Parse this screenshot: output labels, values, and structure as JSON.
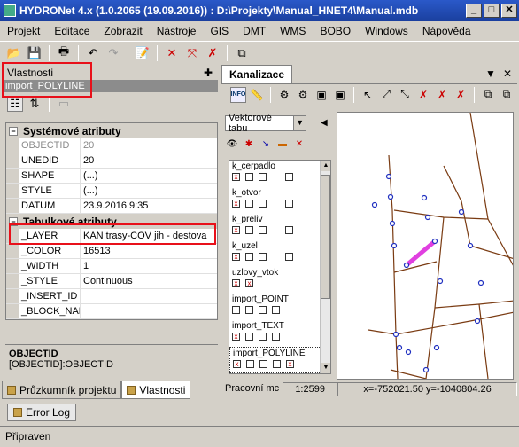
{
  "window": {
    "title": "HYDRONet 4.x (1.0.2065 (19.09.2016)) : D:\\Projekty\\Manual_HNET4\\Manual.mdb",
    "min": "_",
    "max": "□",
    "close": "✕"
  },
  "menu": [
    "Projekt",
    "Editace",
    "Zobrazit",
    "Nástroje",
    "GIS",
    "DMT",
    "WMS",
    "BOBO",
    "Windows",
    "Nápověda"
  ],
  "properties": {
    "header": "Vlastnosti",
    "pin": "✚",
    "object": "import_POLYLINE",
    "categories": [
      {
        "label": "Systémové atributy",
        "toggle": "−"
      },
      {
        "label": "Tabulkové atributy",
        "toggle": "−"
      }
    ],
    "system_rows": [
      {
        "key": "OBJECTID",
        "value": "20"
      },
      {
        "key": "UNEDID",
        "value": "20"
      },
      {
        "key": "SHAPE",
        "value": "(...)"
      },
      {
        "key": "STYLE",
        "value": "(...)"
      },
      {
        "key": "DATUM",
        "value": "23.9.2016 9:35"
      }
    ],
    "table_rows": [
      {
        "key": "_LAYER",
        "value": "KAN trasy-COV jih - destova"
      },
      {
        "key": "_COLOR",
        "value": "16513"
      },
      {
        "key": "_WIDTH",
        "value": "1"
      },
      {
        "key": "_STYLE",
        "value": "Continuous"
      },
      {
        "key": "_INSERT_ID",
        "value": ""
      },
      {
        "key": "_BLOCK_NAM",
        "value": ""
      }
    ],
    "desc_title": "OBJECTID",
    "desc_text": "[OBJECTID]:OBJECTID"
  },
  "left_tabs": [
    "Průzkumník projektu",
    "Vlastnosti"
  ],
  "error_tab": "Error Log",
  "status": "Připraven",
  "map_panel": {
    "tab": "Kanalizace",
    "menu_glyph": "▼",
    "close_glyph": "✕",
    "info_label": "INFO",
    "combo_value": "Vektorové tabu",
    "layers": [
      {
        "name": "k_cerpadlo",
        "checks": [
          "x",
          "",
          "",
          "",
          ""
        ]
      },
      {
        "name": "k_otvor",
        "checks": [
          "x",
          "",
          "",
          "",
          ""
        ]
      },
      {
        "name": "k_preliv",
        "checks": [
          "x",
          "",
          "",
          "",
          ""
        ]
      },
      {
        "name": "k_uzel",
        "checks": [
          "x",
          "",
          "",
          "",
          ""
        ]
      },
      {
        "name": "uzlovy_vtok",
        "checks": [
          "x",
          "x",
          "",
          "",
          ""
        ]
      },
      {
        "name": "import_POINT",
        "checks": [
          "",
          "",
          "",
          "",
          ""
        ]
      },
      {
        "name": "import_TEXT",
        "checks": [
          "x",
          "",
          "",
          "",
          "x"
        ]
      },
      {
        "name": "import_POLYLINE",
        "checks": [
          "x",
          "",
          "",
          "",
          "x"
        ]
      }
    ],
    "status_left": "Pracovní mc",
    "scale": "1:2599",
    "coords": "x=-752021.50 y=-1040804.26"
  },
  "colors": {
    "title_bar": "#1a3f9e",
    "highlight_box": "#e8101a",
    "pipe": "#7a3b12",
    "selected_pipe": "#e040e0",
    "node": "#2030c0"
  }
}
